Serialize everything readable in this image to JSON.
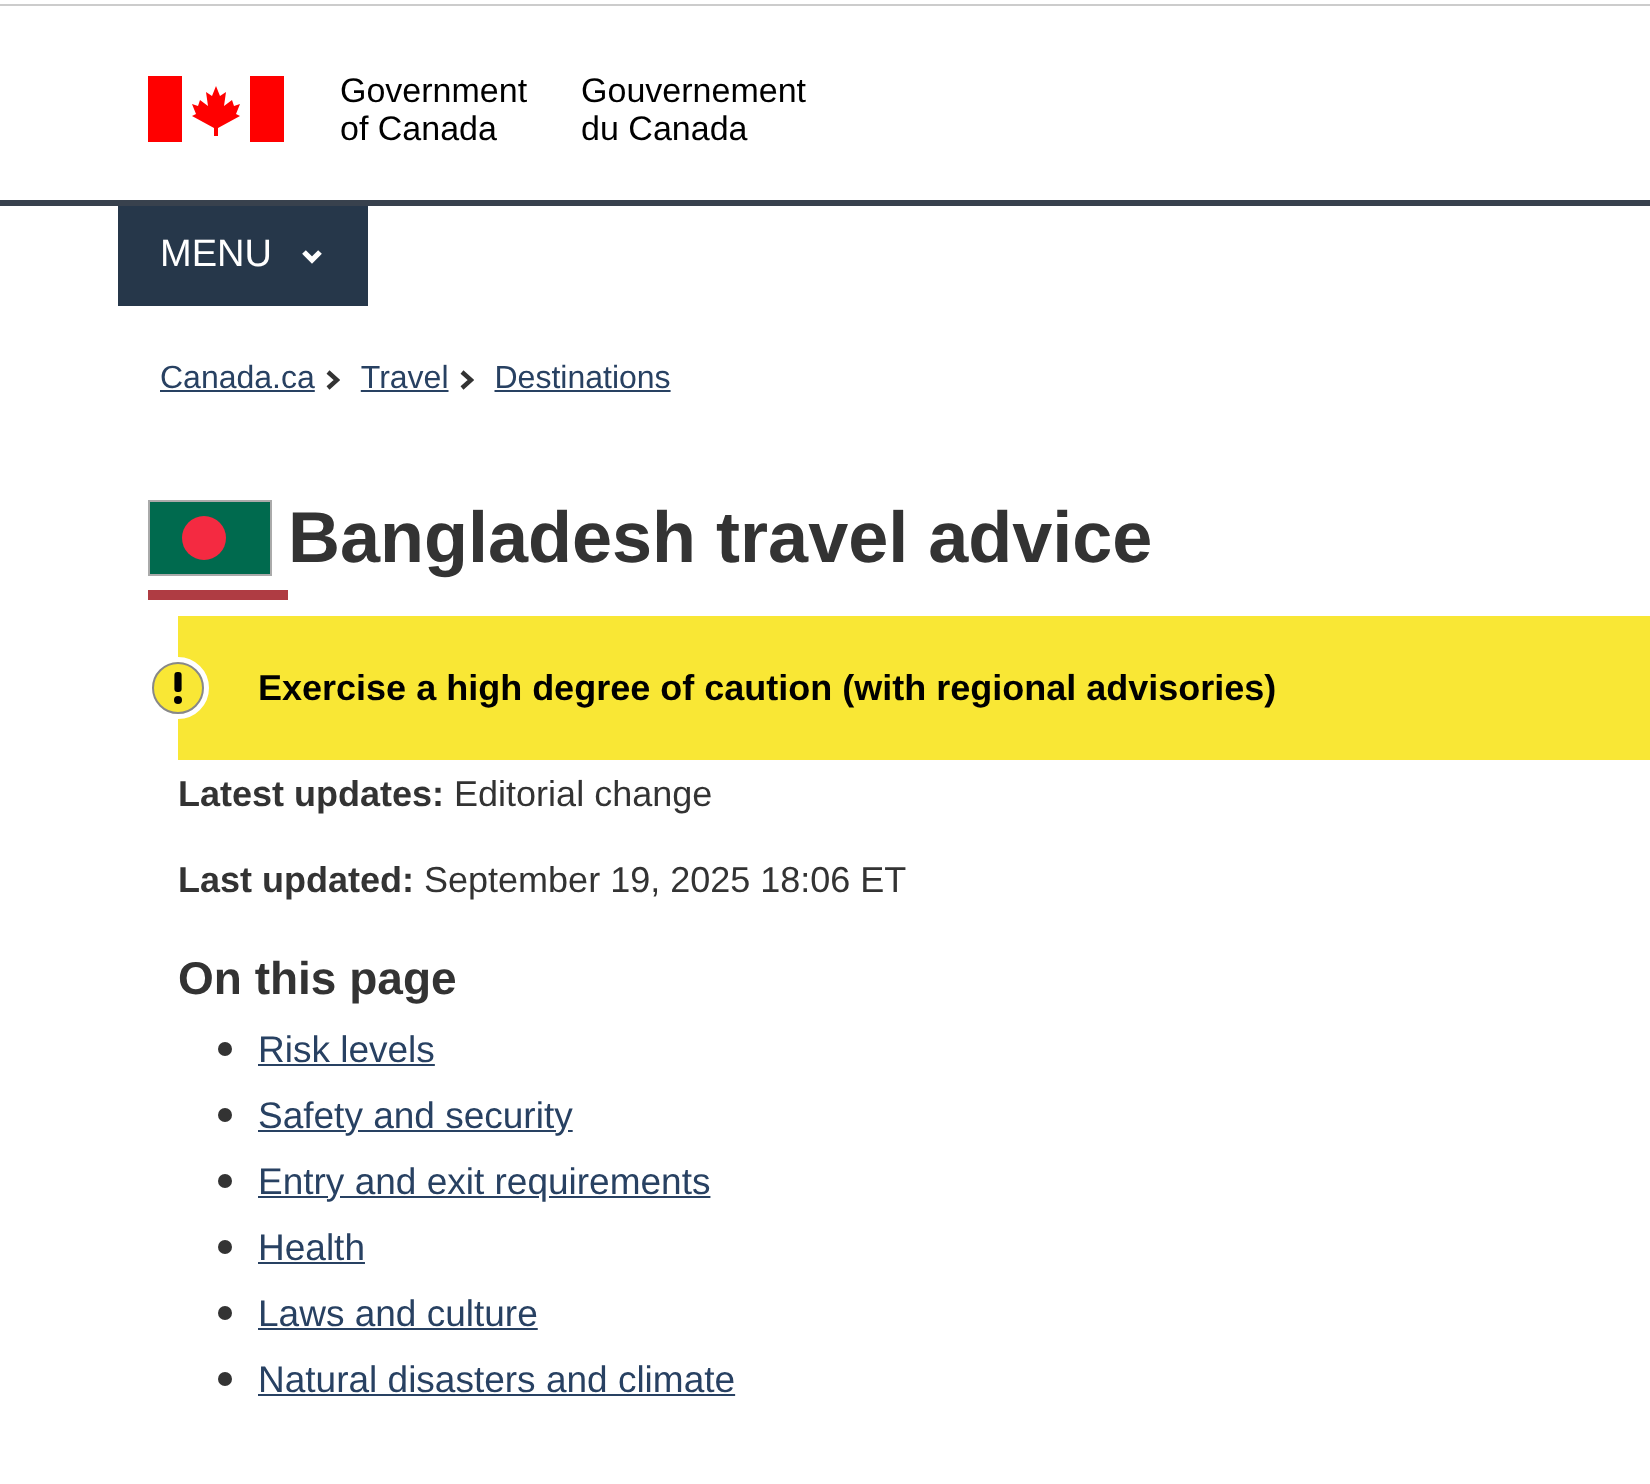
{
  "header": {
    "logo_en": [
      "Government",
      "of Canada"
    ],
    "logo_fr": [
      "Gouvernement",
      "du Canada"
    ]
  },
  "menu_button": {
    "label": "MENU"
  },
  "breadcrumbs": [
    "Canada.ca",
    "Travel",
    "Destinations"
  ],
  "title": "Bangladesh travel advice",
  "alert": {
    "text": "Exercise a high degree of caution (with regional advisories)"
  },
  "meta": [
    "**Latest updates:** Editorial change",
    "**Last updated:** September 19, 2025 18:06 ET"
  ],
  "toc": {
    "heading": "On this page",
    "items": [
      "Risk levels",
      "Safety and security",
      "Entry and exit requirements",
      "Health",
      "Laws and culture",
      "Natural disasters and climate"
    ]
  }
}
